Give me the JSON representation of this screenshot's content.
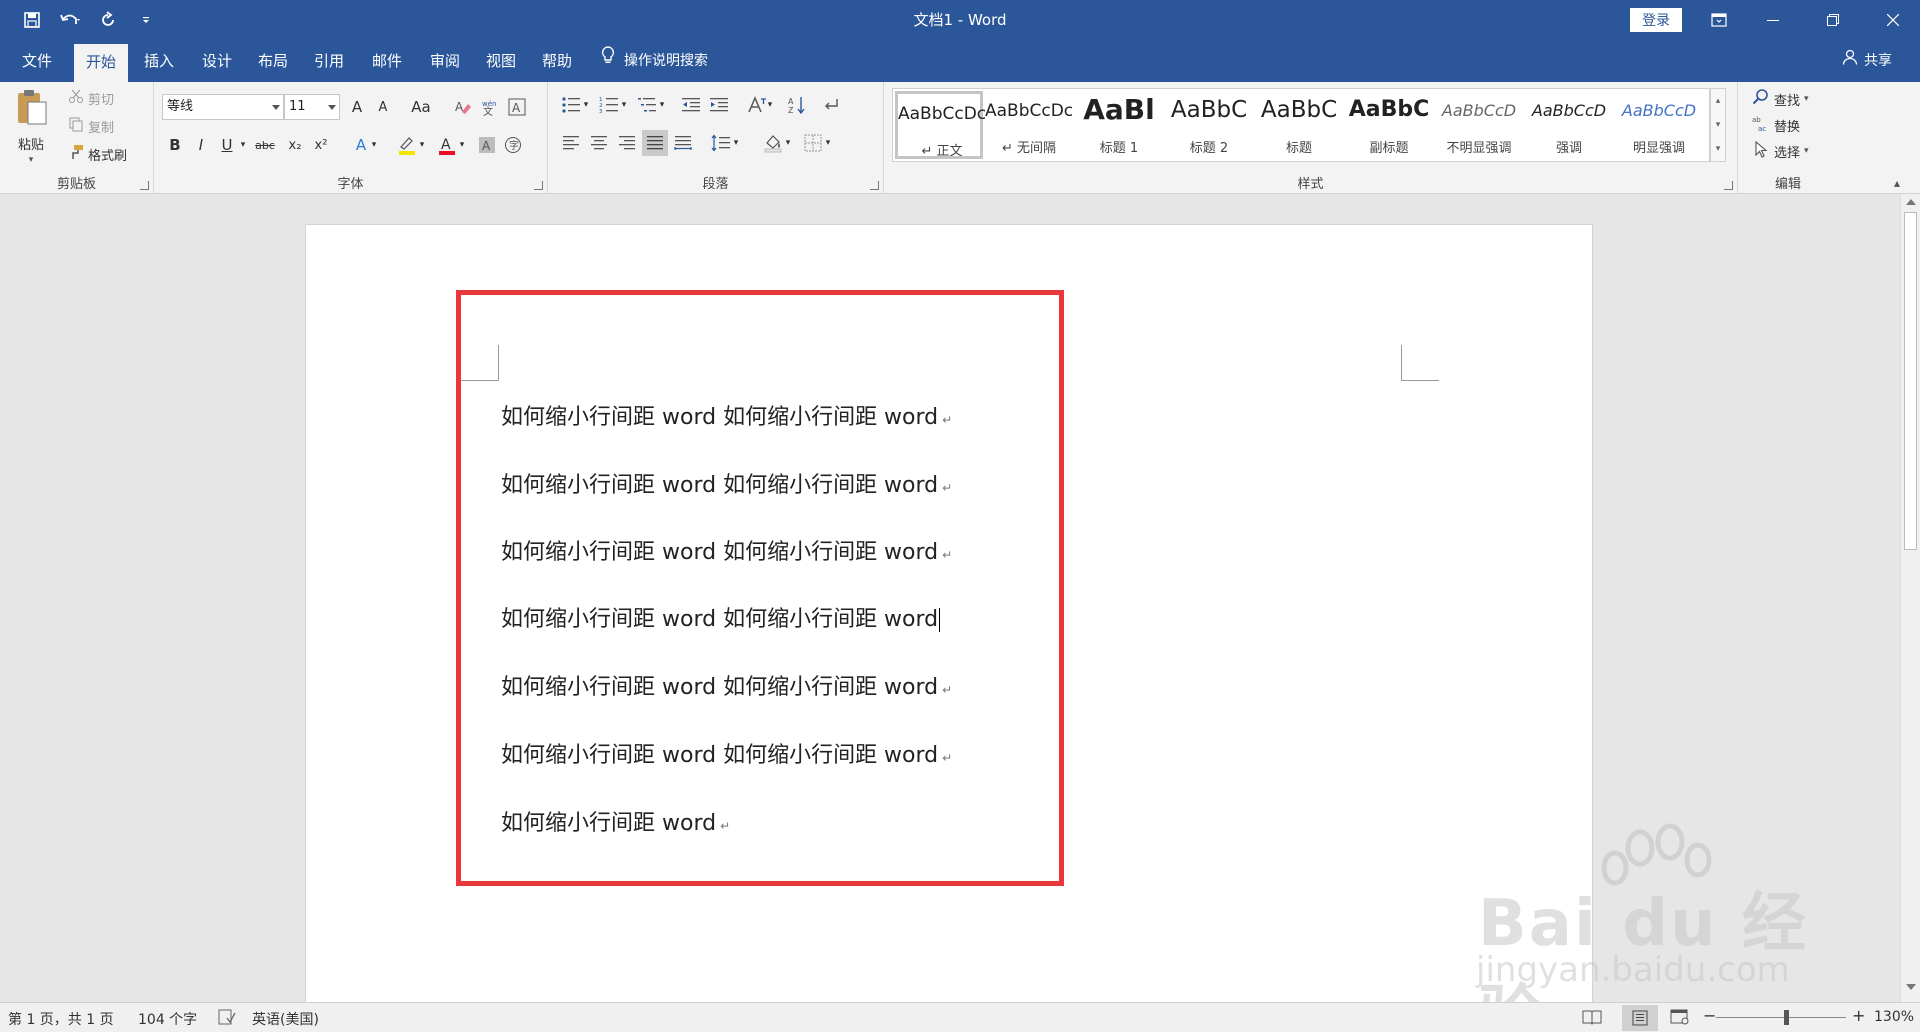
{
  "window": {
    "title": "文档1  -  Word",
    "login": "登录"
  },
  "tabs": [
    "文件",
    "开始",
    "插入",
    "设计",
    "布局",
    "引用",
    "邮件",
    "审阅",
    "视图",
    "帮助"
  ],
  "tell_me": "操作说明搜索",
  "share": "共享",
  "clipboard": {
    "paste": "粘贴",
    "cut": "剪切",
    "copy": "复制",
    "format_painter": "格式刷",
    "label": "剪贴板"
  },
  "font": {
    "name": "等线",
    "size": "11",
    "label": "字体",
    "bold": "B",
    "italic": "I",
    "underline": "U",
    "strike": "abc",
    "sub": "x₂",
    "sup": "x²",
    "change_case": "Aa",
    "grow": "A",
    "shrink": "A"
  },
  "paragraph": {
    "label": "段落"
  },
  "styles": {
    "label": "样式",
    "items": [
      {
        "sample": "AaBbCcDc",
        "name": "↵ 正文"
      },
      {
        "sample": "AaBbCcDc",
        "name": "↵ 无间隔"
      },
      {
        "sample": "AaBl",
        "name": "标题 1"
      },
      {
        "sample": "AaBbC",
        "name": "标题 2"
      },
      {
        "sample": "AaBbC",
        "name": "标题"
      },
      {
        "sample": "AaBbC",
        "name": "副标题"
      },
      {
        "sample": "AaBbCcD",
        "name": "不明显强调"
      },
      {
        "sample": "AaBbCcD",
        "name": "强调"
      },
      {
        "sample": "AaBbCcD",
        "name": "明显强调"
      }
    ]
  },
  "editing": {
    "label": "编辑",
    "find": "查找",
    "replace": "替换",
    "select": "选择"
  },
  "document": {
    "paragraphs": [
      "如何缩小行间距 word 如何缩小行间距 word",
      "如何缩小行间距 word 如何缩小行间距 word",
      "如何缩小行间距 word 如何缩小行间距 word",
      "如何缩小行间距 word 如何缩小行间距 word",
      "如何缩小行间距 word 如何缩小行间距 word",
      "如何缩小行间距 word 如何缩小行间距 word",
      "如何缩小行间距 word"
    ],
    "paragraph_mark": "↵"
  },
  "watermark": {
    "brand": "Bai du 经验",
    "url": "jingyan.baidu.com"
  },
  "status": {
    "page": "第 1 页，共 1 页",
    "words": "104 个字",
    "language": "英语(美国)",
    "zoom": "130%",
    "zoom_percent": 130
  },
  "colors": {
    "brand": "#2b579a",
    "highlight_box": "#e8383a"
  }
}
